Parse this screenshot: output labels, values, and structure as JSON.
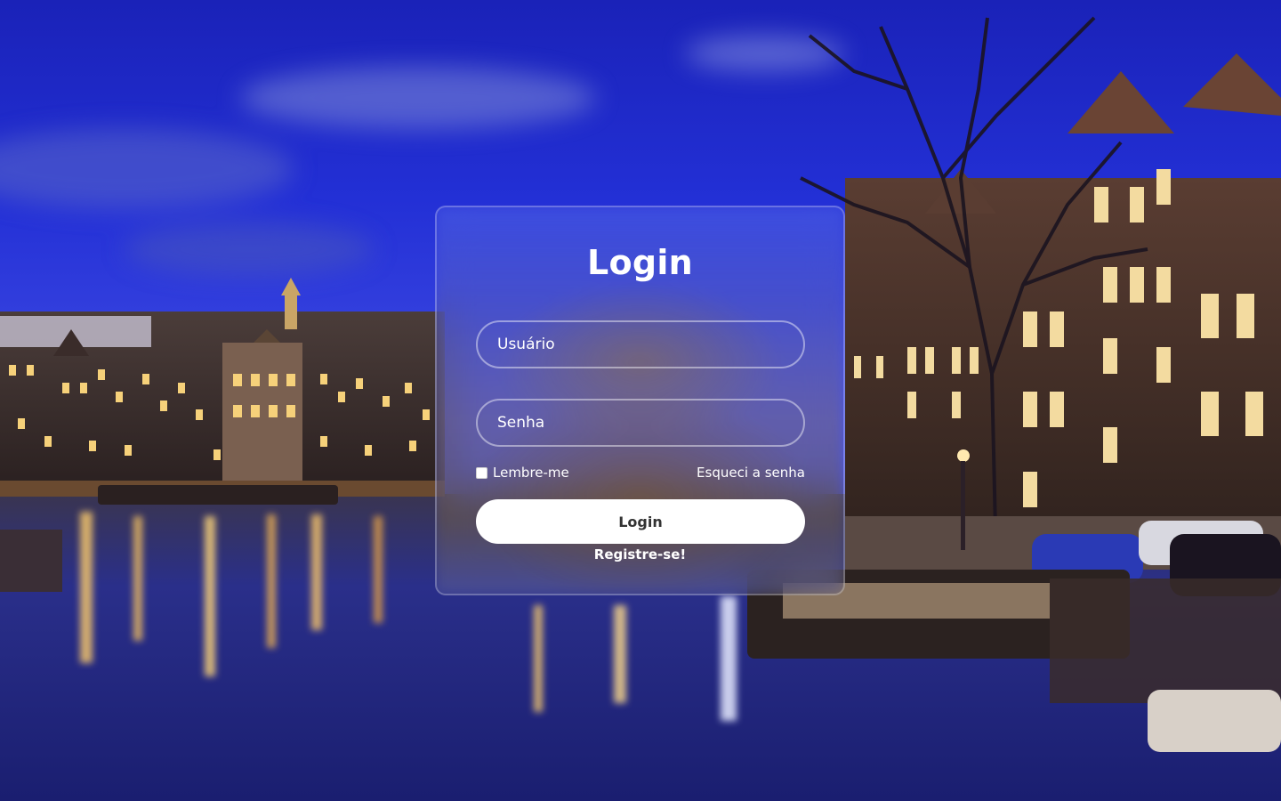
{
  "form": {
    "title": "Login",
    "username_placeholder": "Usuário",
    "password_placeholder": "Senha",
    "remember_label": "Lembre-me",
    "forgot_label": "Esqueci a senha",
    "submit_label": "Login",
    "register_label": "Registre-se!"
  },
  "colors": {
    "sky": "#1f2bd1",
    "card_border": "#ffffff",
    "button_bg": "#ffffff",
    "button_text": "#333333"
  }
}
